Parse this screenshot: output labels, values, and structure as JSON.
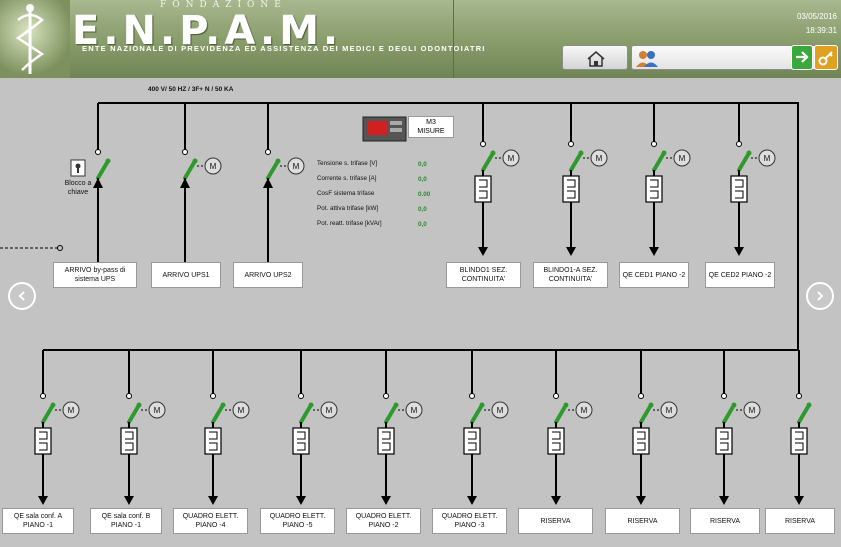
{
  "header": {
    "foundation": "FONDAZIONE",
    "name": "E.N.P.A.M.",
    "subtitle": "ENTE NAZIONALE DI PREVIDENZA ED ASSISTENZA DEI MEDICI E DEGLI ODONTOIATRI",
    "date": "03/05/2016",
    "time": "18:39:31"
  },
  "toolbar": {
    "home_icon": "home-icon",
    "users_icon": "users-icon",
    "go_icon": "arrow-right-icon",
    "key_icon": "key-icon"
  },
  "diagram": {
    "bus_label": "400 V/ 50 HZ / 3F+ N / 50 KA",
    "m3_label": "M3",
    "m3_sub": "MISURE",
    "blocco_label": "Blocco a chiave",
    "motor_label": "M",
    "measures": [
      {
        "label": "Tensione s. trifase [V]",
        "value": "0,0"
      },
      {
        "label": "Corrente s. trifase [A]",
        "value": "0,0"
      },
      {
        "label": "CosF sistema trifase",
        "value": "0.00"
      },
      {
        "label": "Pot. attiva trifase [kW]",
        "value": "0,0"
      },
      {
        "label": "Pot. reatt. trifase [kVAr]",
        "value": "0,0"
      }
    ],
    "top_feeders": [
      "ARRIVO by-pass di sistema UPS",
      "ARRIVO UPS1",
      "ARRIVO UPS2",
      "BLINDO1 SEZ. CONTINUITA'",
      "BLINDO1-A SEZ. CONTINUITA'",
      "QE CED1 PIANO -2",
      "QE CED2 PIANO -2"
    ],
    "bottom_feeders": [
      "QE sala conf. A PIANO -1",
      "QE sala conf. B PIANO -1",
      "QUADRO ELETT. PIANO -4",
      "QUADRO ELETT. PIANO -5",
      "QUADRO ELETT. PIANO -2",
      "QUADRO ELETT. PIANO -3",
      "RISERVA",
      "RISERVA",
      "RISERVA",
      "RISERVA"
    ]
  },
  "colors": {
    "switch_green": "#2e9a2e",
    "header_green": "#8da070",
    "background": "#c3c3c3"
  }
}
